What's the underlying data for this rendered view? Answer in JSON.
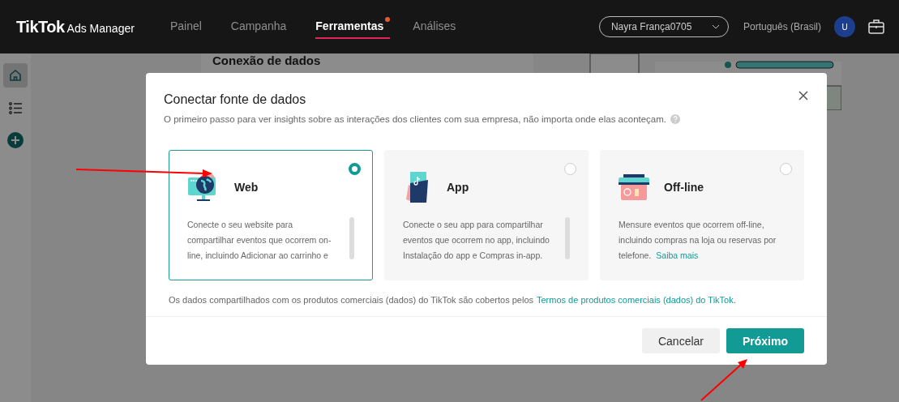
{
  "header": {
    "logo": "TikTok",
    "logo_suffix": "Ads Manager",
    "nav": [
      {
        "label": "Painel",
        "selected": false,
        "badge": false
      },
      {
        "label": "Campanha",
        "selected": false,
        "badge": false
      },
      {
        "label": "Ferramentas",
        "selected": true,
        "badge": true
      },
      {
        "label": "Análises",
        "selected": false,
        "badge": false
      }
    ],
    "account": "Nayra França0705",
    "language": "Português (Brasil)",
    "avatar": "U"
  },
  "sidebar": {
    "items": [
      {
        "kind": "home",
        "selected": true
      },
      {
        "kind": "list",
        "selected": false
      },
      {
        "kind": "add",
        "selected": false
      }
    ]
  },
  "background": {
    "section_title": "Conexão de dados"
  },
  "dialog": {
    "title": "Conectar fonte de dados",
    "subtitle": "O primeiro passo para ver insights sobre as interações dos clientes com sua empresa, não importa onde elas aconteçam.",
    "options": [
      {
        "kind": "web",
        "title": "Web",
        "description": "Conecte o seu website para compartilhar eventos que ocorrem on-line, incluindo Adicionar ao carrinho e",
        "scrollbar": true,
        "selected": true
      },
      {
        "kind": "app",
        "title": "App",
        "description": "Conecte o seu app para compartilhar eventos que ocorrem no app, incluindo Instalação do app e Compras in-app.",
        "scrollbar": true,
        "selected": false
      },
      {
        "kind": "offline",
        "title": "Off-line",
        "description": "Mensure eventos que ocorrem off-line, incluindo compras na loja ou reservas por telefone.",
        "link": "Saiba mais",
        "scrollbar": false,
        "selected": false
      }
    ],
    "terms_text": "Os dados compartilhados com os produtos comerciais (dados) do TikTok são cobertos pelos",
    "terms_link": "Termos de produtos comerciais (dados) do TikTok",
    "terms_end": ".",
    "buttons": [
      {
        "kind": "secondary",
        "label": "Cancelar"
      },
      {
        "kind": "primary",
        "label": "Próximo"
      }
    ]
  }
}
